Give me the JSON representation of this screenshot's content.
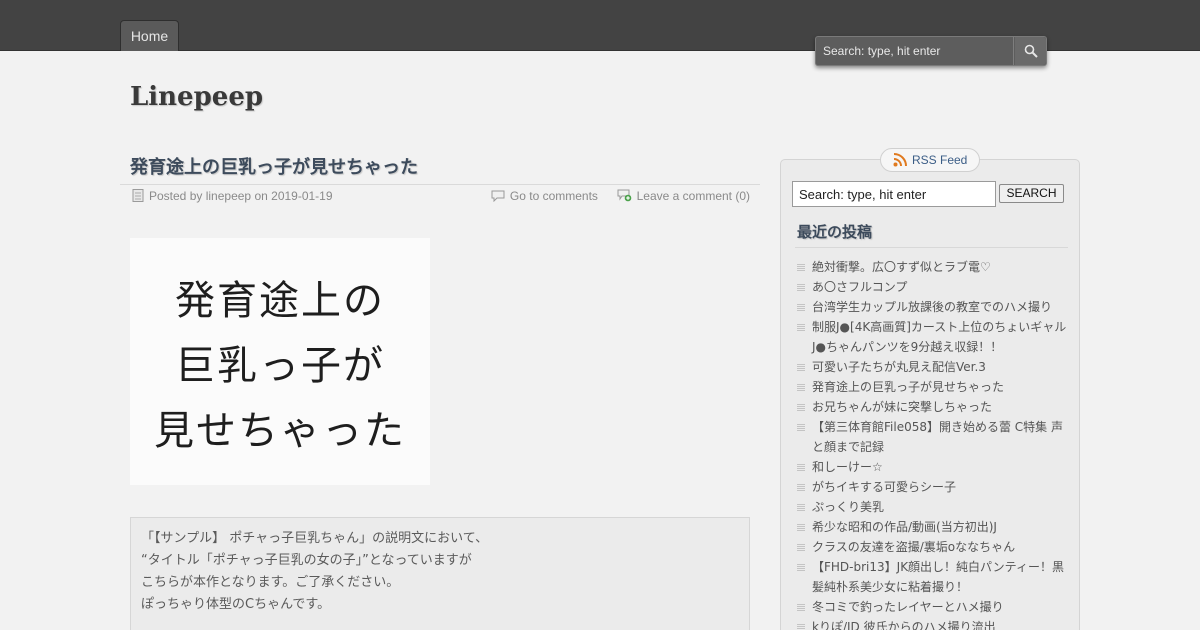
{
  "nav": {
    "home_label": "Home"
  },
  "top_search": {
    "placeholder": "Search: type, hit enter"
  },
  "site": {
    "title": "Linepeep"
  },
  "post": {
    "title": "発育途上の巨乳っ子が見せちゃった",
    "meta": {
      "posted_by_prefix": "Posted by",
      "author": "linepeep",
      "on_text": "on",
      "date": "2019-01-19",
      "go_to_comments": "Go to comments",
      "leave_comment": "Leave a comment (0)"
    },
    "image_lines": [
      "発育途上の",
      "巨乳っ子が",
      "見せちゃった"
    ],
    "excerpt": [
      "「【サンプル】 ポチャっ子巨乳ちゃん」の説明文において、",
      "“タイトル「ポチャっ子巨乳の女の子」”となっていますが",
      "こちらが本作となります。ご了承ください。",
      "ぽっちゃり体型のCちゃんです。"
    ]
  },
  "sidebar": {
    "rss_label": "RSS Feed",
    "search_value": "Search: type, hit enter",
    "search_button": "SEARCH",
    "recent_title": "最近の投稿",
    "recent_posts": [
      "絶対衝撃。広〇すず似とラブ電♡",
      "あ〇さフルコンプ",
      "台湾学生カップル放課後の教室でのハメ撮り",
      "制服J●[4K高画質]カースト上位のちょいギャルJ●ちゃんパンツを9分越え収録！！",
      "可愛い子たちが丸見え配信Ver.3",
      "発育途上の巨乳っ子が見せちゃった",
      "お兄ちゃんが妹に突撃しちゃった",
      "【第三体育館File058】開き始める蕾 C特集 声と顔まで記録",
      "和しーけー☆",
      "がちイキする可愛らシー子",
      "ぷっくり美乳",
      "希少な昭和の作品/動画(当方初出)J",
      "クラスの友達を盗撮/裏垢oななちゃん",
      "【FHD-bri13】JK顔出し！純白パンティー！黒髪純朴系美少女に粘着撮り！",
      "冬コミで釣ったレイヤーとハメ撮り",
      "kりぽ/JD 彼氏からのハメ撮り流出"
    ]
  }
}
